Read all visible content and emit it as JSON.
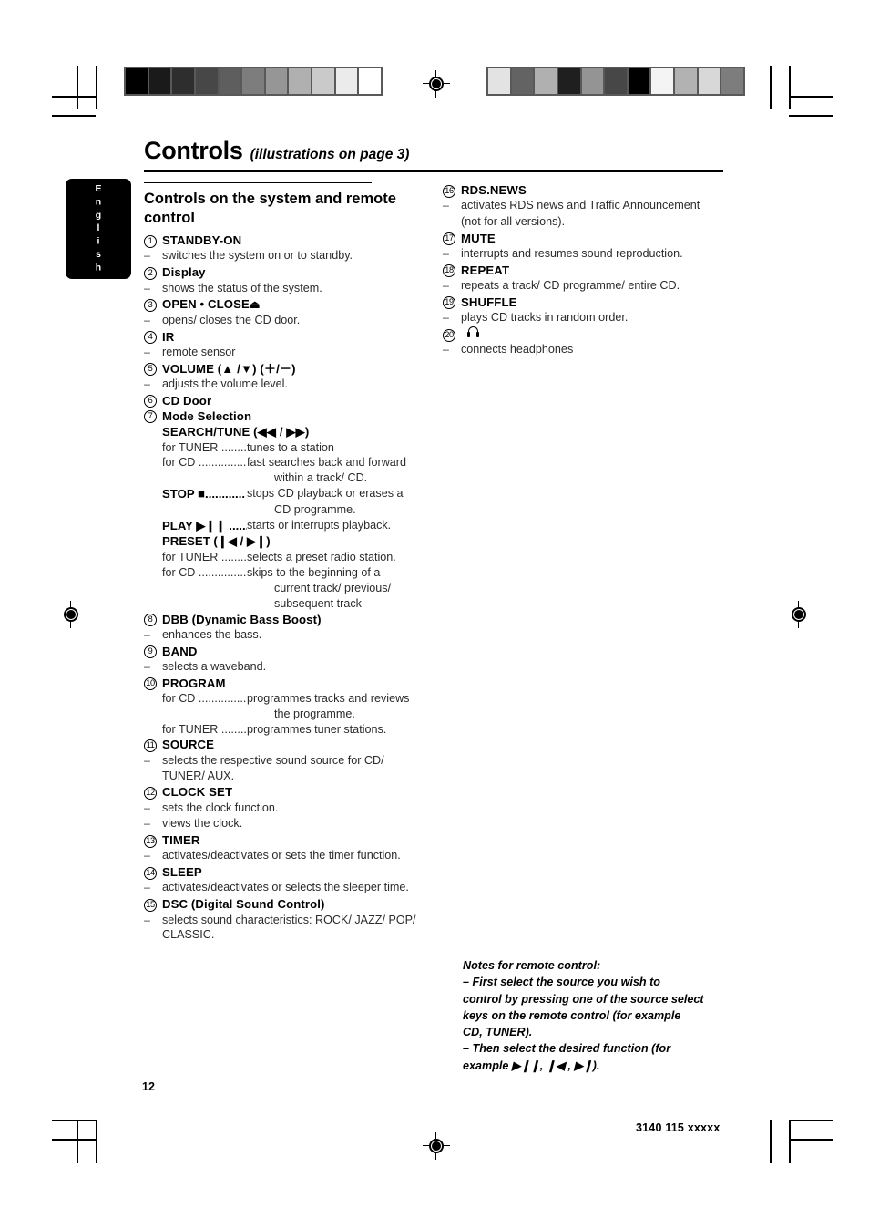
{
  "document": {
    "page_number": "12",
    "doc_code": "3140 115 xxxxx",
    "language_tab": "English"
  },
  "header": {
    "title": "Controls",
    "subtitle": "(illustrations on page 3)"
  },
  "left_column": {
    "section_heading": "Controls on the system and remote control",
    "items": [
      {
        "num": "1",
        "label": "STANDBY-ON",
        "desc": [
          "switches the system on or to standby."
        ]
      },
      {
        "num": "2",
        "label": "Display",
        "desc": [
          "shows the status of the system."
        ]
      },
      {
        "num": "3",
        "label": "OPEN • CLOSE",
        "symbol": "⏏",
        "desc": [
          "opens/ closes the CD door."
        ]
      },
      {
        "num": "4",
        "label": "IR",
        "desc": [
          "remote sensor"
        ]
      },
      {
        "num": "5",
        "label": "VOLUME (▲ /▼) (＋/－)",
        "desc": [
          "adjusts the volume level."
        ]
      },
      {
        "num": "6",
        "label": "CD Door",
        "desc": []
      },
      {
        "num": "7",
        "label": "Mode Selection",
        "desc": [],
        "sub_label": "SEARCH/TUNE  (◀◀ / ▶▶)",
        "rows": [
          {
            "key": "for TUNER ........",
            "value": "tunes to a station"
          },
          {
            "key": "for CD ................",
            "value": "fast searches back and forward"
          },
          {
            "key": "",
            "value": "within a track/ CD.",
            "cont": true
          },
          {
            "key": "STOP ■............",
            "value": "stops CD playback or erases a",
            "bold": true
          },
          {
            "key": "",
            "value": "CD programme.",
            "cont": true
          },
          {
            "key": "PLAY ▶❙❙ ......",
            "value": "starts or interrupts playback.",
            "bold": true
          },
          {
            "key": "PRESET (❙◀ / ▶❙)",
            "value": "",
            "bold": true,
            "full": true
          },
          {
            "key": "for TUNER ........",
            "value": "selects a preset radio station."
          },
          {
            "key": "for CD ................",
            "value": "skips to the beginning of a"
          },
          {
            "key": "",
            "value": "current track/ previous/",
            "cont": true
          },
          {
            "key": "",
            "value": "subsequent track",
            "cont": true
          }
        ]
      },
      {
        "num": "8",
        "label": "DBB (Dynamic Bass Boost)",
        "desc": [
          "enhances the bass."
        ]
      },
      {
        "num": "9",
        "label": "BAND",
        "desc": [
          "selects a waveband."
        ]
      },
      {
        "num": "10",
        "label": "PROGRAM",
        "desc": [],
        "rows": [
          {
            "key": "for CD ................",
            "value": "programmes tracks and reviews"
          },
          {
            "key": "",
            "value": "the programme.",
            "cont": true
          },
          {
            "key": "for TUNER ........",
            "value": "programmes tuner stations."
          }
        ]
      },
      {
        "num": "11",
        "label": "SOURCE",
        "desc": [
          "selects the respective sound source for CD/ TUNER/ AUX."
        ]
      },
      {
        "num": "12",
        "label": "CLOCK SET",
        "desc": [
          "sets the clock function.",
          "views the clock."
        ]
      },
      {
        "num": "13",
        "label": "TIMER",
        "desc": [
          "activates/deactivates or sets the timer function."
        ]
      },
      {
        "num": "14",
        "label": "SLEEP",
        "desc": [
          "activates/deactivates or selects the sleeper time."
        ]
      },
      {
        "num": "15",
        "label": "DSC (Digital Sound Control)",
        "desc": [
          "selects sound characteristics: ROCK/ JAZZ/ POP/ CLASSIC."
        ]
      }
    ]
  },
  "right_column": {
    "items": [
      {
        "num": "16",
        "label": "RDS.NEWS",
        "desc": [
          "activates RDS news and Traffic Announcement"
        ],
        "desc_italic": [
          "(not for all versions)."
        ]
      },
      {
        "num": "17",
        "label": "MUTE",
        "desc": [
          "interrupts and resumes sound reproduction."
        ]
      },
      {
        "num": "18",
        "label": "REPEAT",
        "desc": [
          "repeats a track/ CD programme/ entire CD."
        ]
      },
      {
        "num": "19",
        "label": "SHUFFLE",
        "desc": [
          "plays CD tracks in random order."
        ]
      },
      {
        "num": "20",
        "label": "",
        "icon": "headphones-icon",
        "desc": [
          "connects headphones"
        ]
      }
    ]
  },
  "notes": {
    "title": "Notes for remote control:",
    "lines": [
      "–  First select the source you wish to",
      "control by pressing one of the source select",
      "keys on the remote control (for example",
      "CD, TUNER).",
      "–  Then select the desired function (for",
      "example  ▶❙❙, ❙◀ , ▶❙)."
    ]
  },
  "calibration": {
    "left_bar": [
      "#000000",
      "#1a1a1a",
      "#2e2e2e",
      "#474747",
      "#5e5e5e",
      "#7d7d7d",
      "#969696",
      "#b0b0b0",
      "#cacaca",
      "#ebebeb",
      "#ffffff"
    ],
    "right_bar": [
      "#e3e3e3",
      "#636363",
      "#b0b0b0",
      "#1f1f1f",
      "#949494",
      "#474747",
      "#000000",
      "#f4f4f4",
      "#b2b2b2",
      "#d8d8d8",
      "#7d7d7d"
    ]
  }
}
